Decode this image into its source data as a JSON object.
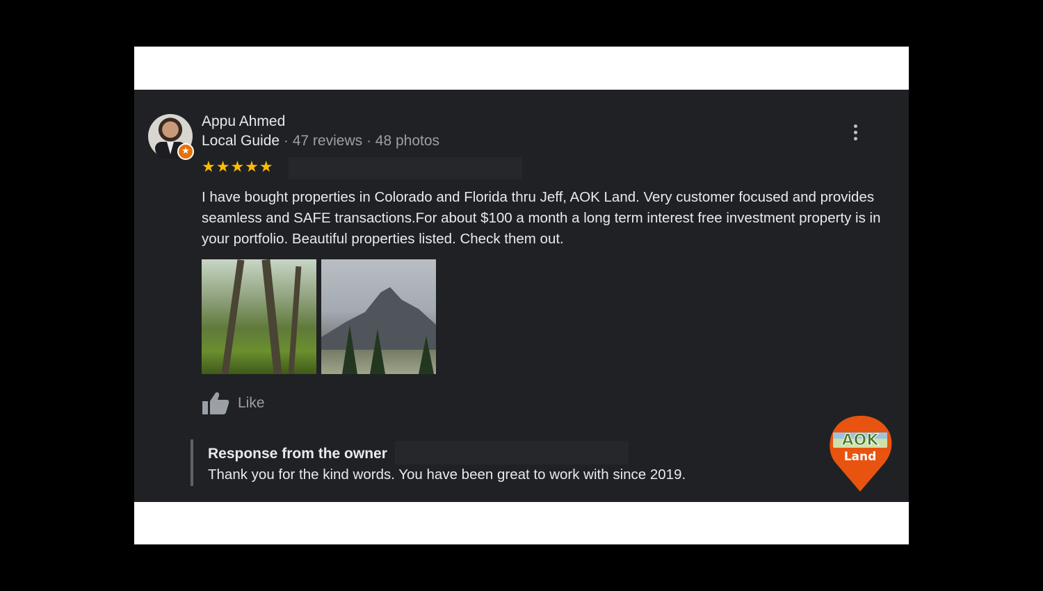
{
  "reviewer": {
    "name": "Appu Ahmed",
    "badge": "Local Guide",
    "stats": " · 47 reviews · 48 photos"
  },
  "rating": {
    "stars": 5,
    "display": "★★★★★"
  },
  "review": {
    "text": "I have bought properties in Colorado and Florida thru Jeff, AOK Land. Very customer focused and provides seamless and SAFE transactions.For about $100 a month a long term interest free investment property is in your portfolio. Beautiful properties listed. Check them out."
  },
  "photos": [
    {
      "icon": "forest-photo"
    },
    {
      "icon": "mountain-photo"
    }
  ],
  "actions": {
    "like_label": "Like"
  },
  "owner_response": {
    "title": "Response from the owner",
    "text": "Thank you for the kind words. You have been great to work with since 2019."
  },
  "logo": {
    "line1": "AOK",
    "line2": "Land"
  },
  "colors": {
    "card_bg": "#202124",
    "text_primary": "#e8eaed",
    "text_secondary": "#9aa0a6",
    "star": "#fbbc04",
    "guide_badge": "#e8710a",
    "logo_pin": "#e8540f"
  }
}
